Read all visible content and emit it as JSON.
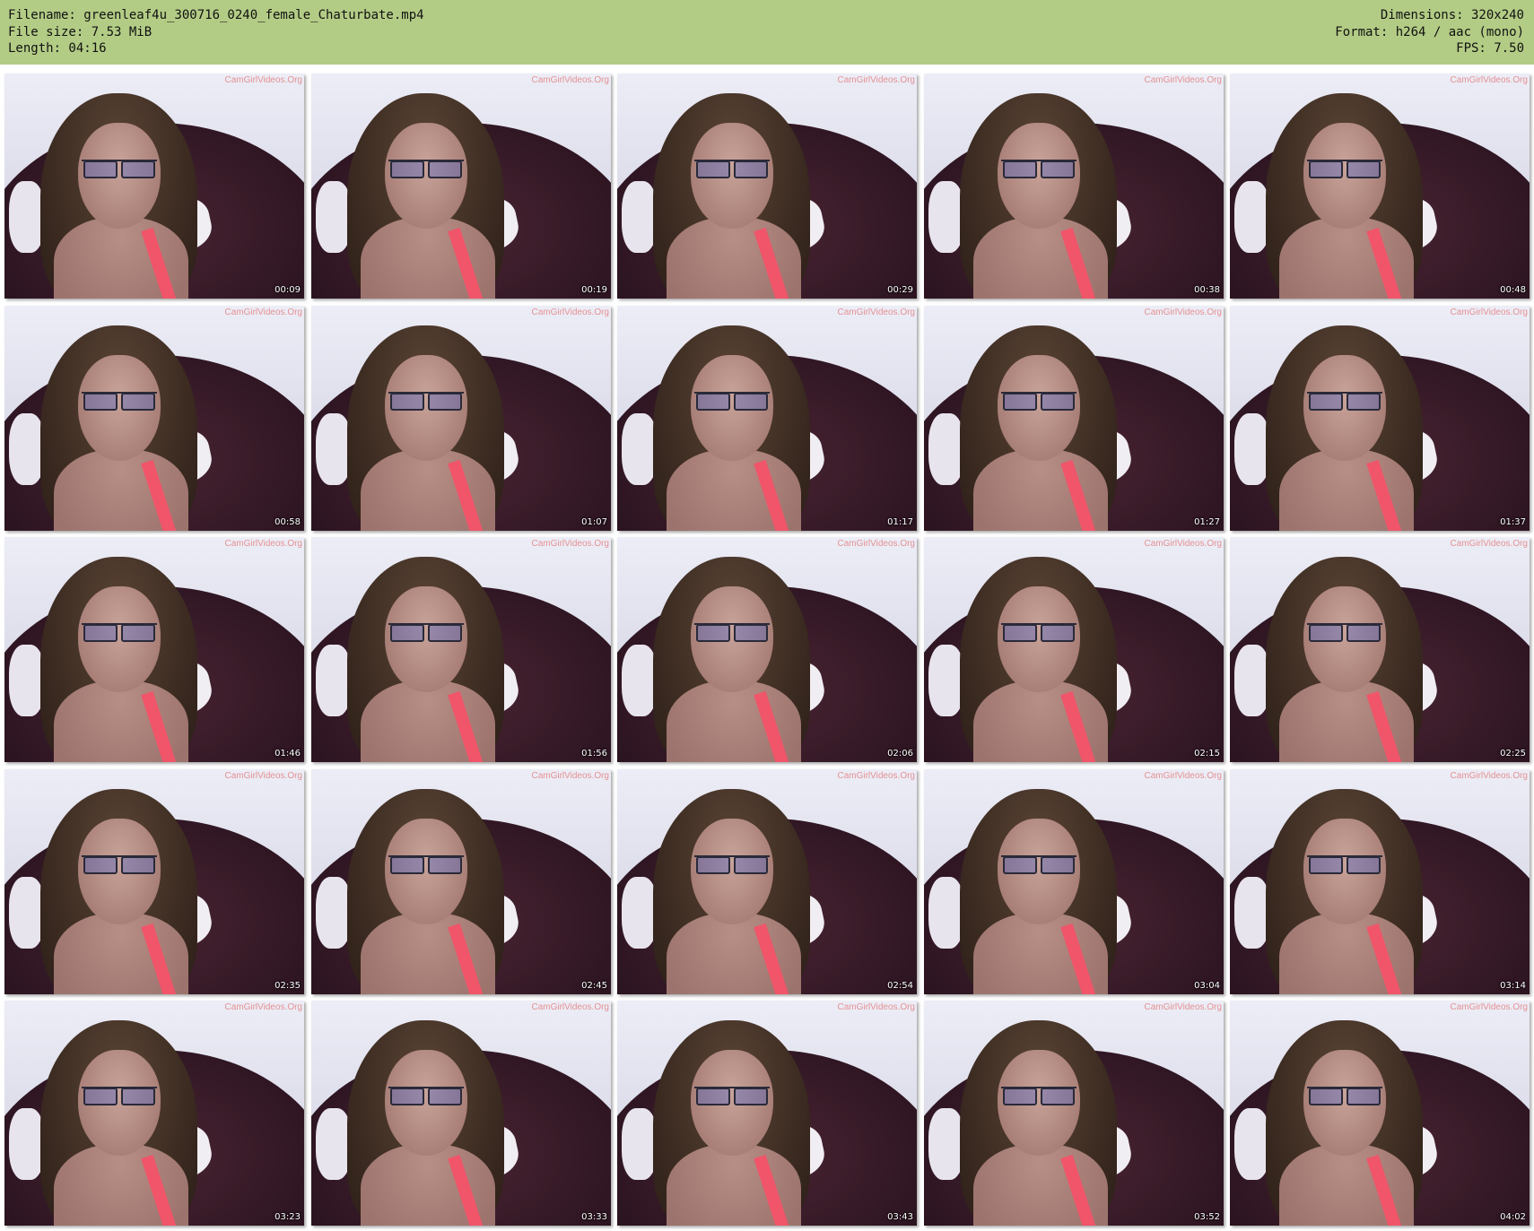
{
  "header": {
    "filename": "Filename: greenleaf4u_300716_0240_female_Chaturbate.mp4",
    "filesize": "File size: 7.53 MiB",
    "length": "Length: 04:16",
    "dimensions": "Dimensions: 320x240",
    "format": "Format: h264 / aac (mono)",
    "fps": "FPS: 7.50"
  },
  "colors": {
    "header_bg": "#b3cc85",
    "page_bg": "#ffffff"
  },
  "watermark": "CamGirlVideos.Org",
  "thumbnails": [
    {
      "time": "00:09"
    },
    {
      "time": "00:19"
    },
    {
      "time": "00:29"
    },
    {
      "time": "00:38"
    },
    {
      "time": "00:48"
    },
    {
      "time": "00:58"
    },
    {
      "time": "01:07"
    },
    {
      "time": "01:17"
    },
    {
      "time": "01:27"
    },
    {
      "time": "01:37"
    },
    {
      "time": "01:46"
    },
    {
      "time": "01:56"
    },
    {
      "time": "02:06"
    },
    {
      "time": "02:15"
    },
    {
      "time": "02:25"
    },
    {
      "time": "02:35"
    },
    {
      "time": "02:45"
    },
    {
      "time": "02:54"
    },
    {
      "time": "03:04"
    },
    {
      "time": "03:14"
    },
    {
      "time": "03:23"
    },
    {
      "time": "03:33"
    },
    {
      "time": "03:43"
    },
    {
      "time": "03:52"
    },
    {
      "time": "04:02"
    }
  ]
}
